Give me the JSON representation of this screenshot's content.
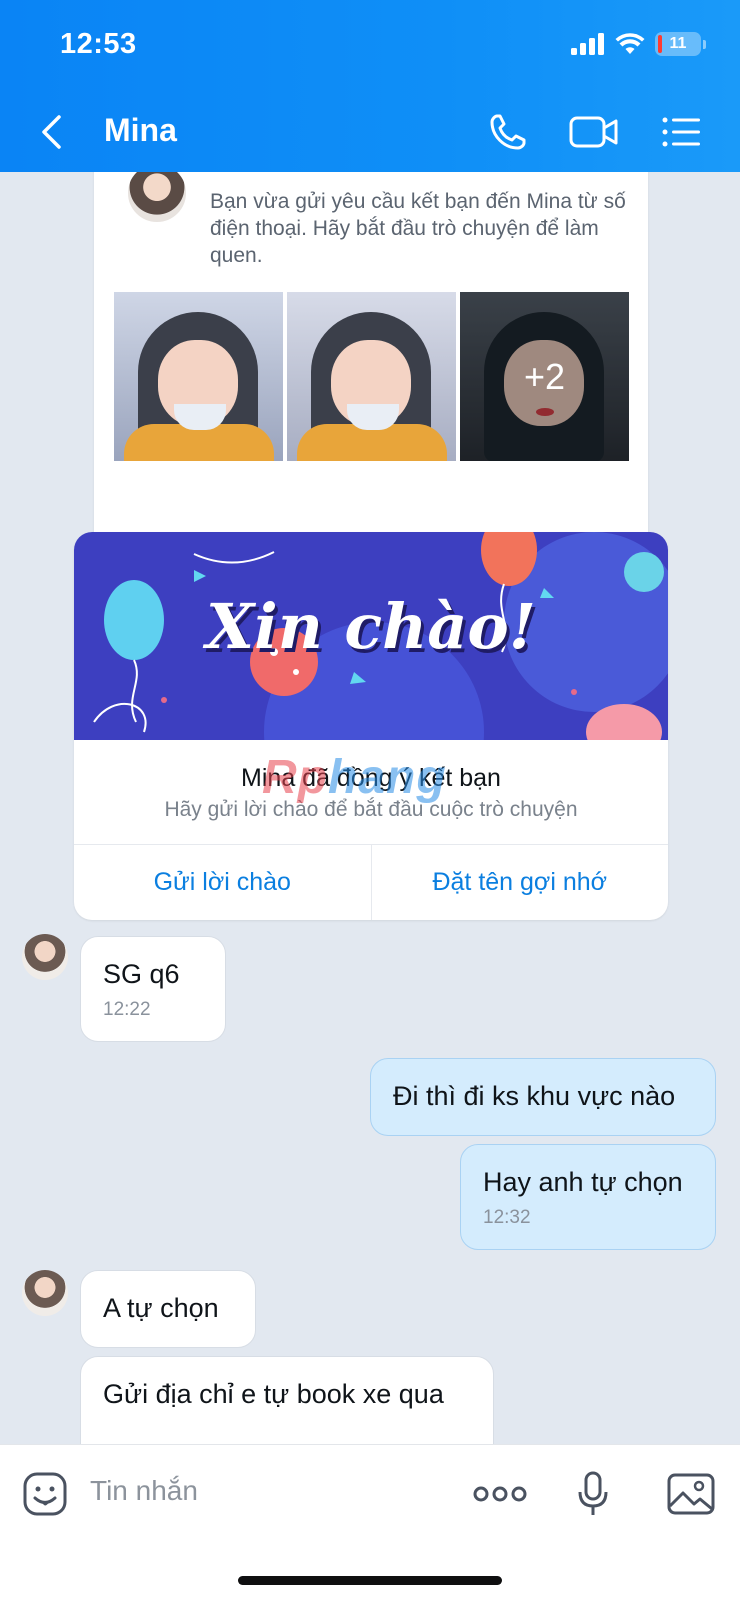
{
  "status_bar": {
    "time": "12:53",
    "battery": "11"
  },
  "nav": {
    "title": "Mina",
    "back_icon": "chevron-left-icon",
    "call_icon": "phone-icon",
    "video_icon": "video-camera-icon",
    "menu_icon": "list-menu-icon"
  },
  "intro_card": {
    "text": "Bạn vừa gửi yêu cầu kết bạn đến Mina từ số điện thoại. Hãy bắt đầu trò chuyện để làm quen.",
    "more_photos": "+2"
  },
  "greeting_card": {
    "banner_text": "Xin chào!",
    "title": "Mina đã đồng ý kết bạn",
    "subtitle": "Hãy gửi lời chào để bắt đầu cuộc trò chuyện",
    "action_greet": "Gửi lời chào",
    "action_nickname": "Đặt tên gợi nhớ"
  },
  "watermark": {
    "part1": "Rp",
    "part2": "hang"
  },
  "messages": [
    {
      "side": "in",
      "text": "SG q6",
      "time": "12:22"
    },
    {
      "side": "out",
      "text": "Đi thì đi ks khu vực nào",
      "time": ""
    },
    {
      "side": "out",
      "text": "Hay anh tự chọn",
      "time": "12:32"
    },
    {
      "side": "in",
      "text": "A tự chọn",
      "time": ""
    },
    {
      "side": "in",
      "text": "Gửi địa chỉ e tự book xe qua",
      "time": ""
    }
  ],
  "input": {
    "placeholder": "Tin nhắn"
  },
  "colors": {
    "header": "#0a84f5",
    "out_bubble": "#d4ecfd",
    "in_bubble": "#ffffff",
    "link": "#0b7fe0",
    "banner": "#3d3fc0"
  }
}
